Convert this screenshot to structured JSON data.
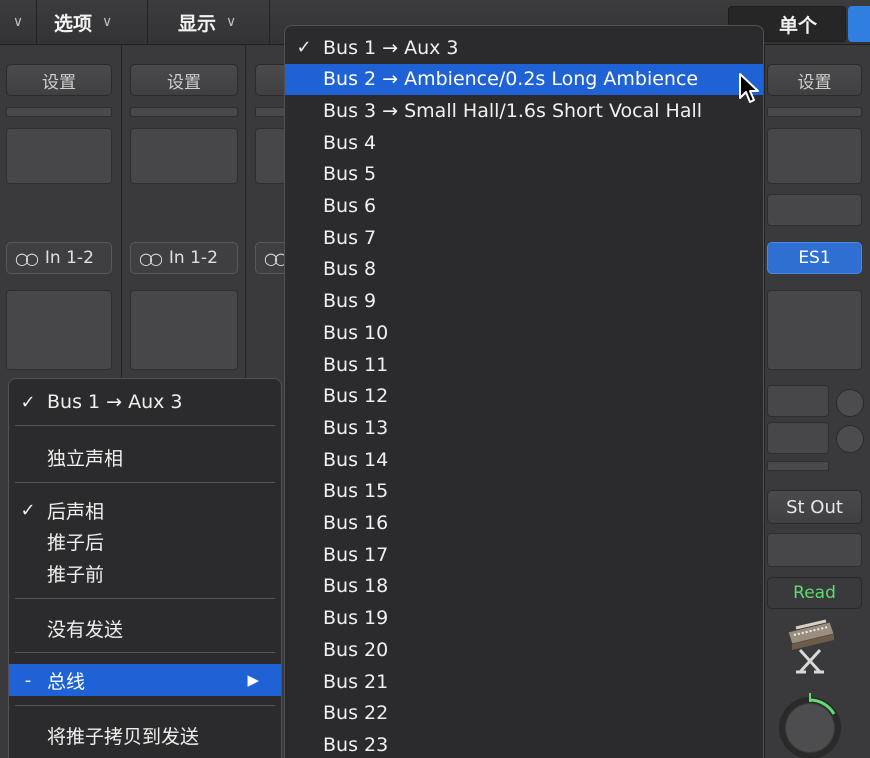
{
  "toolbar": {
    "options_label": "选项",
    "view_label": "显示",
    "single_label": "单个"
  },
  "strips": {
    "settings_label": "设置",
    "input_label": "In 1-2"
  },
  "right_strip": {
    "settings_label": "设置",
    "instrument": "ES1",
    "output": "St Out",
    "automation": "Read"
  },
  "send_menu": {
    "current_bus": "Bus 1 → Aux 3",
    "independent_pan": "独立声相",
    "post_pan": "后声相",
    "post_fader": "推子后",
    "pre_fader": "推子前",
    "no_send": "没有发送",
    "bus_dash": "-",
    "bus_label": "总线",
    "copy_fader": "将推子拷贝到发送"
  },
  "bus_menu": {
    "items": [
      "Bus 1 → Aux 3",
      "Bus 2 → Ambience/0.2s Long Ambience",
      "Bus 3 → Small Hall/1.6s Short Vocal Hall",
      "Bus 4",
      "Bus 5",
      "Bus 6",
      "Bus 7",
      "Bus 8",
      "Bus 9",
      "Bus 10",
      "Bus 11",
      "Bus 12",
      "Bus 13",
      "Bus 14",
      "Bus 15",
      "Bus 16",
      "Bus 17",
      "Bus 18",
      "Bus 19",
      "Bus 20",
      "Bus 21",
      "Bus 22",
      "Bus 23"
    ],
    "checked_index": 0,
    "highlighted_index": 1
  },
  "colors": {
    "accent": "#1f62d6",
    "read_green": "#5fdc6e"
  },
  "icons": {
    "checkmark": "checkmark-icon",
    "submenu": "submenu-arrow-icon",
    "link": "stereo-link-icon",
    "cursor": "mouse-pointer-icon",
    "synth": "synthesizer-icon",
    "knob": "pan-knob-icon"
  }
}
